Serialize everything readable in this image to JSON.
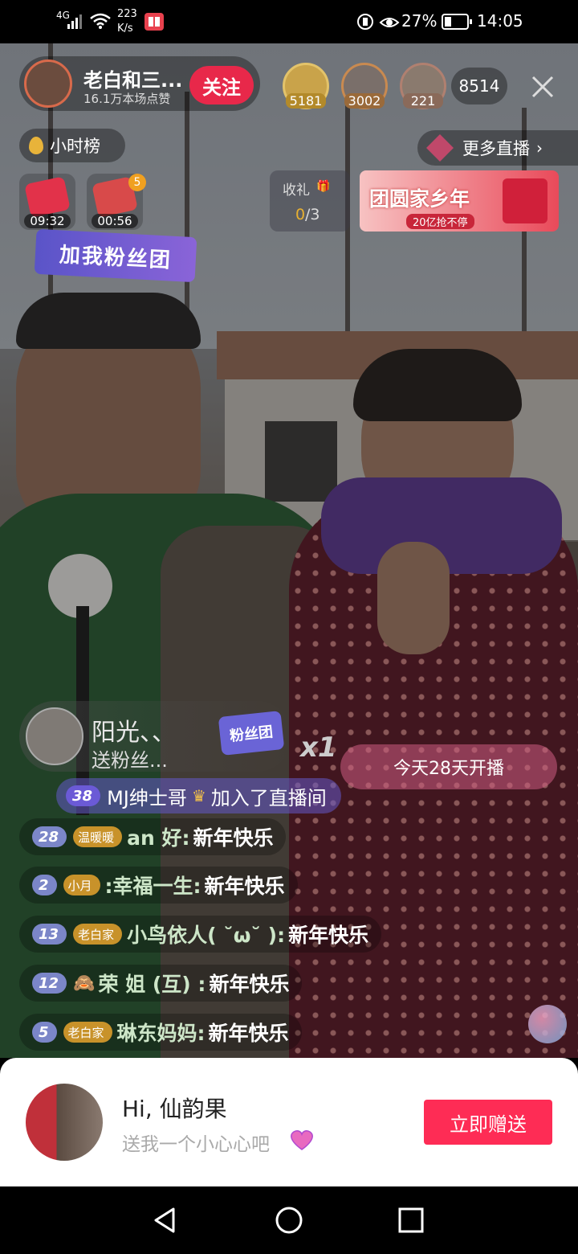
{
  "status_bar": {
    "network": "4G",
    "speed_value": "223",
    "speed_unit": "K/s",
    "battery_percent": "27%",
    "time": "14:05"
  },
  "streamer": {
    "name": "老白和三...",
    "likes": "16.1万本场点赞",
    "follow_label": "关注"
  },
  "viewers": {
    "top1_count": "5181",
    "top2_count": "3002",
    "top3_count": "221",
    "total": "8514"
  },
  "hour_rank_label": "小时榜",
  "more_live_label": "更多直播",
  "timers": {
    "first": "09:32",
    "second": "00:56",
    "second_badge": "5"
  },
  "gift_task": {
    "label": "收礼",
    "progress_current": "0",
    "progress_total": "/3"
  },
  "banner": {
    "title": "团圆家乡年",
    "subtitle": "20亿抢不停"
  },
  "fan_club_sticker": "加我粉丝团",
  "gift_notice": {
    "user": "阳光、、",
    "action": "送粉丝...",
    "gift_name": "粉丝团",
    "multiplier": "x1"
  },
  "streak_label": "今天28天开播",
  "join_notice": {
    "level": "38",
    "user": "MJ绅士哥",
    "action": "加入了直播间"
  },
  "chat": [
    {
      "level": "28",
      "badge": "温暖暖",
      "name": "an 好:",
      "message": "新年快乐"
    },
    {
      "level": "2",
      "badge": "小月",
      "name": ":幸福一生:",
      "message": "新年快乐"
    },
    {
      "level": "13",
      "badge": "老白家",
      "name": "小鸟依人( ˘ω˘ ):",
      "message": "新年快乐"
    },
    {
      "level": "12",
      "badge": "",
      "name": "荣 姐 (互) :",
      "message": "新年快乐"
    },
    {
      "level": "5",
      "badge": "老白家",
      "name": "琳东妈妈:",
      "message": "新年快乐"
    }
  ],
  "gift_prompt": {
    "greeting": "Hi, 仙韵果",
    "subtitle": "送我一个小心心吧",
    "button": "立即赠送"
  },
  "colors": {
    "accent": "#fe2c55",
    "follow": "#e8284a"
  }
}
